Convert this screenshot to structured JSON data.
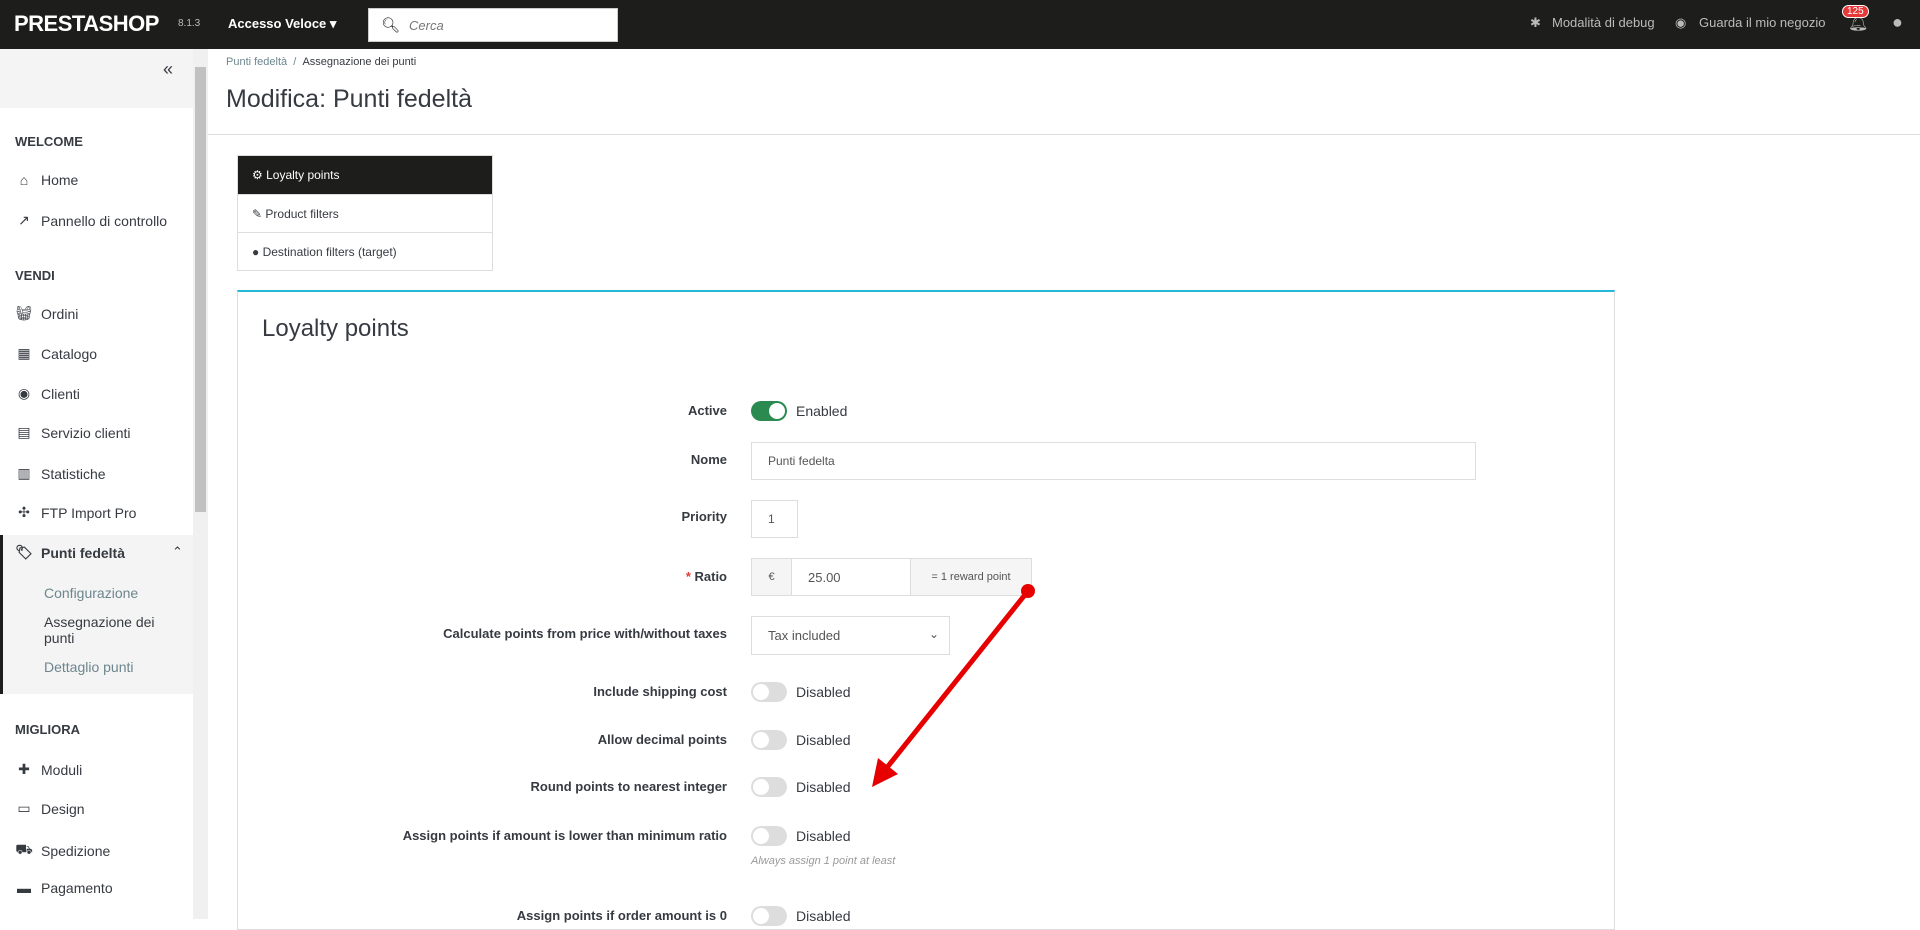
{
  "topbar": {
    "logo": "PRESTASHOP",
    "version": "8.1.3",
    "quick_access": "Accesso Veloce ▾",
    "search_placeholder": "Cerca",
    "debug": "Modalità di debug",
    "view_shop": "Guarda il mio negozio",
    "notifications": "125"
  },
  "sidebar": {
    "collapse": "«",
    "sections": {
      "welcome": "WELCOME",
      "vendi": "VENDI",
      "migliora": "MIGLIORA"
    },
    "items": [
      "Home",
      "Pannello di controllo",
      "Ordini",
      "Catalogo",
      "Clienti",
      "Servizio clienti",
      "Statistiche",
      "FTP Import Pro",
      "Punti fedeltà",
      "Moduli",
      "Design",
      "Spedizione",
      "Pagamento"
    ],
    "sub": [
      "Configurazione",
      "Assegnazione dei punti",
      "Dettaglio punti"
    ]
  },
  "breadcrumb": {
    "parent": "Punti fedeltà",
    "current": "Assegnazione dei punti"
  },
  "page_title": "Modifica: Punti fedeltà",
  "tabs": [
    "Loyalty points",
    "Product filters",
    "Destination filters (target)"
  ],
  "panel": {
    "title": "Loyalty points",
    "active": {
      "label": "Active",
      "value": "Enabled"
    },
    "name": {
      "label": "Nome",
      "value": "Punti fedelta"
    },
    "priority": {
      "label": "Priority",
      "value": "1"
    },
    "ratio": {
      "required": "*",
      "label": "Ratio",
      "currency": "€",
      "value": "25.00",
      "suffix": "= 1 reward point"
    },
    "calc": {
      "label": "Calculate points from price with/without taxes",
      "value": "Tax included"
    },
    "shipping": {
      "label": "Include shipping cost",
      "value": "Disabled"
    },
    "decimal": {
      "label": "Allow decimal points",
      "value": "Disabled"
    },
    "round": {
      "label": "Round points to nearest integer",
      "value": "Disabled"
    },
    "lower": {
      "label": "Assign points if amount is lower than minimum ratio",
      "value": "Disabled",
      "help": "Always assign 1 point at least"
    },
    "zero": {
      "label": "Assign points if order amount is 0",
      "value": "Disabled"
    }
  },
  "colors": {
    "accent": "#25b9d7",
    "enabled": "#2b8a4f",
    "annotation": "#e60000"
  }
}
